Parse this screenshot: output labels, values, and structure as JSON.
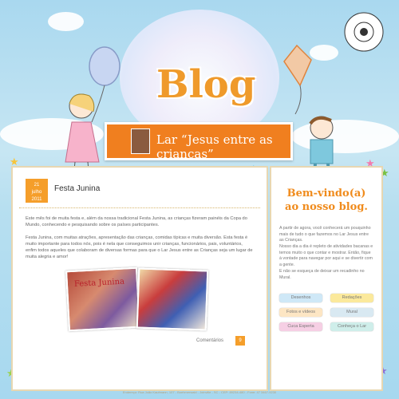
{
  "header": {
    "title": "Blog",
    "banner_text": "Lar “Jesus entre as crianças”"
  },
  "post": {
    "date_day": "21",
    "date_month": "julho",
    "date_year": "2011",
    "title": "Festa Junina",
    "paragraph1": "Este mês foi de muita festa e, além da nossa tradicional Festa Junina, as crianças fizeram painéis da Copa do Mundo, conhecendo e pesquisando sobre os países participantes.",
    "paragraph2": "Festa Junina, com muitas atrações, apresentação das crianças, comidas típicas e muita diversão. Esta festa é muito importante para todos nós, pois é nela que conseguimos unir crianças, funcionários, pais, voluntários, enfim todos aqueles que colaboram de diversas formas para que o Lar Jesus entre as Crianças seja um lugar de muita alegria e amor!",
    "photo_text": "Festa Junina",
    "comments_label": "Comentários",
    "comments_count": "9"
  },
  "sidebar": {
    "welcome_line1": "Bem-vindo(a)",
    "welcome_line2": "ao nosso blog.",
    "text1": "A partir de agora, você conhecerá um pouquinho mais de tudo o que fazemos no Lar Jesus entre as Crianças.",
    "text2": "Nosso dia a dia é repleto de atividades bacanas e temos muito o que contar e mostrar. Então, fique à vontade para navegar por aqui e se divertir com a gente.",
    "text3": "E não se esqueça de deixar um recadinho no Mural.",
    "buttons": [
      {
        "label": "Desenhos",
        "color": "#cfe8f7"
      },
      {
        "label": "Redações",
        "color": "#fbe99c"
      },
      {
        "label": "Fotos e vídeos",
        "color": "#fde6c4"
      },
      {
        "label": "Mural",
        "color": "#d9e9f2"
      },
      {
        "label": "Cuca Esperta",
        "color": "#f6cfe4"
      },
      {
        "label": "Conheça o Lar",
        "color": "#cfeeea"
      }
    ]
  },
  "footer": {
    "text": "Endereço: Rua João Kaufmann, 107 - Boehmerwald - Joinville - SC - CEP: 89234-480 - Fone: 47 3467-9230"
  },
  "colors": {
    "accent_orange": "#f07f1f",
    "title_orange": "#ef9a2b",
    "sky": "#a9d8ef"
  }
}
